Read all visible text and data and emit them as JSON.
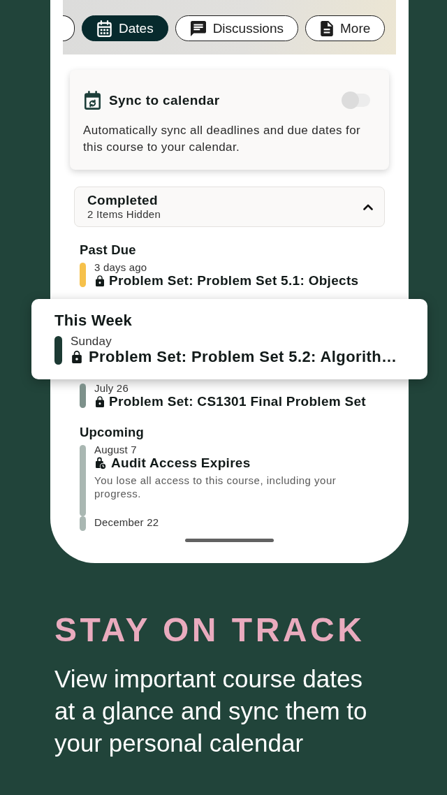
{
  "header": {
    "tabs": [
      {
        "kind": "cut-off",
        "selected": false
      },
      {
        "kind": "dates",
        "label": "Dates",
        "selected": true
      },
      {
        "kind": "discussions",
        "label": "Discussions",
        "selected": false
      },
      {
        "kind": "more",
        "label": "More",
        "selected": false
      }
    ]
  },
  "sync_card": {
    "title": "Sync to calendar",
    "on": false,
    "description": "Automatically sync all deadlines and due dates for this course to your calendar."
  },
  "completed": {
    "title": "Completed",
    "subtitle": "2 Items Hidden",
    "collapsed": true
  },
  "timeline": [
    {
      "kind": "section",
      "heading": "Past Due",
      "items": [
        {
          "kind": "assignment",
          "date": "3 days ago",
          "title": "Problem Set: Problem Set 5.1: Objects",
          "color": "#f6c14b"
        }
      ]
    },
    {
      "kind": "callout",
      "heading": "This Week",
      "items": [
        {
          "kind": "assignment",
          "date": "Sunday",
          "title": "Problem Set: Problem Set 5.2: Algorith…",
          "color": "#1c3a33"
        }
      ]
    },
    {
      "kind": "section",
      "items": [
        {
          "kind": "assignment",
          "date": "July 26",
          "title": "Problem Set: CS1301 Final Problem Set",
          "color": "#7d918b"
        }
      ]
    },
    {
      "kind": "section",
      "heading": "Upcoming",
      "items": [
        {
          "kind": "access",
          "date": "August 7",
          "title": "Audit Access Expires",
          "description": "You lose all access to this course, including your progress.",
          "color": "#a9b7b2"
        },
        {
          "date": "December 22",
          "color": "#a9b7b2"
        }
      ]
    }
  ],
  "promo": {
    "headline": "STAY ON TRACK",
    "text": "View important course dates at a glance and sync them to your personal calendar"
  }
}
